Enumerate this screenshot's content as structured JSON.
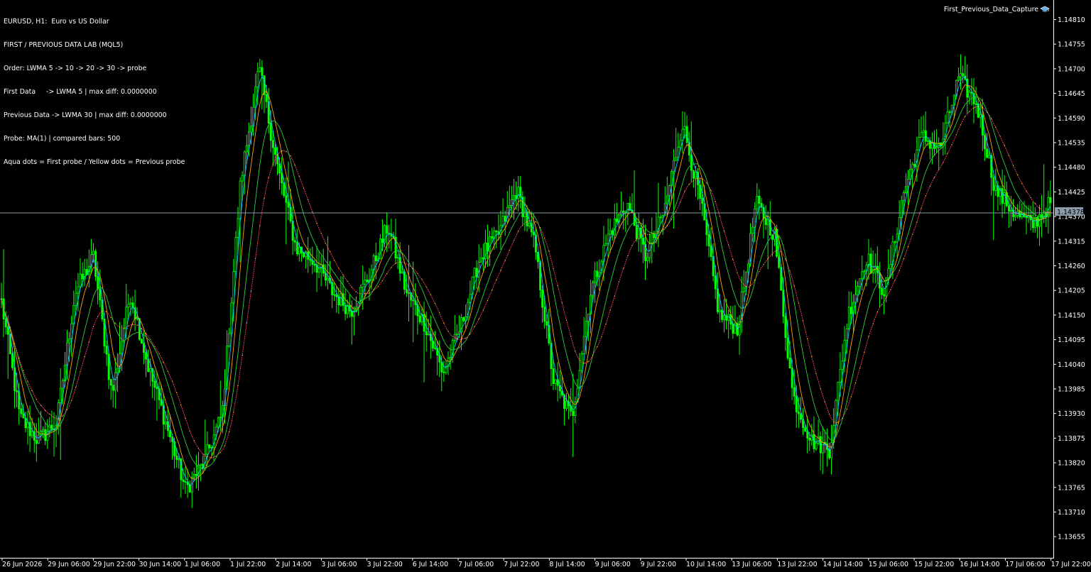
{
  "header": {
    "symbol_line": "EURUSD, H1:  Euro vs US Dollar",
    "lines": [
      "FIRST / PREVIOUS DATA LAB (MQL5)",
      "Order: LWMA 5 -> 10 -> 20 -> 30 -> probe",
      "First Data     -> LWMA 5 | max diff: 0.0000000",
      "Previous Data -> LWMA 30 | max diff: 0.0000000",
      "Probe: MA(1) | compared bars: 500",
      "Aqua dots = First probe / Yellow dots = Previous probe"
    ]
  },
  "expert": {
    "name": "First_Previous_Data_Capture",
    "icon": "hat-icon"
  },
  "price_axis": {
    "labels": [
      "1.14810",
      "1.14755",
      "1.14700",
      "1.14645",
      "1.14590",
      "1.14535",
      "1.14480",
      "1.14425",
      "1.14370",
      "1.14315",
      "1.14260",
      "1.14205",
      "1.14150",
      "1.14095",
      "1.14040",
      "1.13985",
      "1.13930",
      "1.13875",
      "1.13820",
      "1.13765",
      "1.13710",
      "1.13655"
    ],
    "bid_label": "1.14378"
  },
  "time_axis": {
    "labels": [
      "26 Jun 2026",
      "29 Jun 06:00",
      "29 Jun 22:00",
      "30 Jun 14:00",
      "1 Jul 06:00",
      "1 Jul 22:00",
      "2 Jul 14:00",
      "3 Jul 06:00",
      "3 Jul 22:00",
      "6 Jul 14:00",
      "7 Jul 06:00",
      "7 Jul 22:00",
      "8 Jul 14:00",
      "9 Jul 06:00",
      "9 Jul 22:00",
      "10 Jul 14:00",
      "13 Jul 06:00",
      "13 Jul 22:00",
      "14 Jul 14:00",
      "15 Jul 06:00",
      "15 Jul 22:00",
      "16 Jul 14:00",
      "17 Jul 06:00",
      "17 Jul 22:00"
    ]
  },
  "colors": {
    "background": "#000000",
    "foreground": "#ffffff",
    "bars": "#00ff00",
    "bid_line": "#8a9aa8",
    "lwma5": "#00c8ff",
    "lwma10": "#ffa500",
    "lwma20": "#2ecc40",
    "lwma30": "#ff4060"
  },
  "chart_data": {
    "type": "line",
    "title": "EURUSD, H1:  Euro vs US Dollar",
    "xlabel": "",
    "ylabel": "",
    "ylim": [
      1.1362,
      1.1485
    ],
    "bid": 1.14378,
    "x_anchor_labels": [
      "26 Jun 2026",
      "29 Jun 06:00",
      "29 Jun 22:00",
      "30 Jun 14:00",
      "1 Jul 06:00",
      "1 Jul 22:00",
      "2 Jul 14:00",
      "3 Jul 06:00",
      "3 Jul 22:00",
      "6 Jul 14:00",
      "7 Jul 06:00",
      "7 Jul 22:00",
      "8 Jul 14:00",
      "9 Jul 06:00",
      "9 Jul 22:00",
      "10 Jul 14:00",
      "13 Jul 06:00",
      "13 Jul 22:00",
      "14 Jul 14:00",
      "15 Jul 06:00",
      "15 Jul 22:00",
      "16 Jul 14:00",
      "17 Jul 06:00",
      "17 Jul 22:00"
    ],
    "price_path": [
      1.1418,
      1.1392,
      1.1387,
      1.1391,
      1.142,
      1.1428,
      1.1397,
      1.142,
      1.1403,
      1.139,
      1.1376,
      1.1382,
      1.1393,
      1.1445,
      1.147,
      1.1448,
      1.143,
      1.1427,
      1.142,
      1.1416,
      1.1424,
      1.1435,
      1.142,
      1.1413,
      1.1402,
      1.1413,
      1.1428,
      1.1433,
      1.1443,
      1.143,
      1.14,
      1.1392,
      1.142,
      1.1433,
      1.144,
      1.1428,
      1.1438,
      1.1458,
      1.144,
      1.1415,
      1.1412,
      1.144,
      1.1433,
      1.1397,
      1.1387,
      1.1385,
      1.1415,
      1.1428,
      1.142,
      1.1442,
      1.1455,
      1.1452,
      1.1468,
      1.1462,
      1.1443,
      1.1438,
      1.1435,
      1.144
    ]
  }
}
